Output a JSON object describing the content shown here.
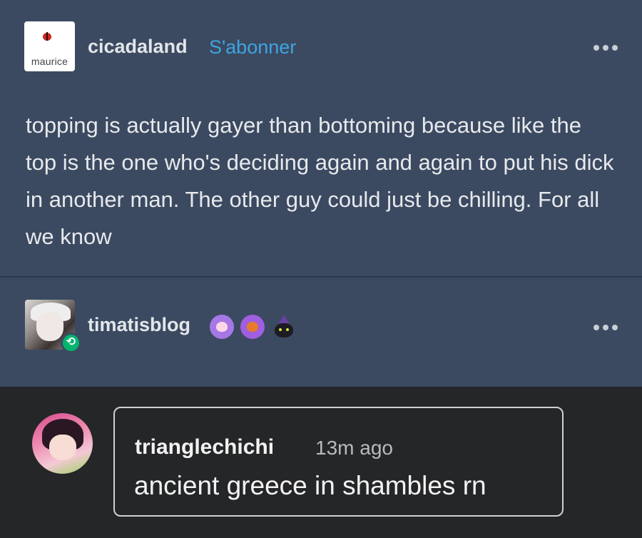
{
  "post": {
    "avatar_text": "maurice",
    "username": "cicadaland",
    "follow_label": "S'abonner",
    "body": "topping is actually gayer than bottoming because like the top is the one who's deciding again and again to put his dick in another man. The other guy could just be chilling. For all we know"
  },
  "reblog": {
    "username": "timatisblog",
    "badges": [
      "paw-pink-icon",
      "paw-orange-icon",
      "witch-cat-icon"
    ]
  },
  "reply": {
    "username": "trianglechichi",
    "time": "13m ago",
    "text": "ancient greece in shambles rn"
  },
  "colors": {
    "post_bg": "#3b4a61",
    "follow": "#3fa4e0",
    "reblog_green": "#00b46e",
    "reply_bg": "#252628"
  }
}
